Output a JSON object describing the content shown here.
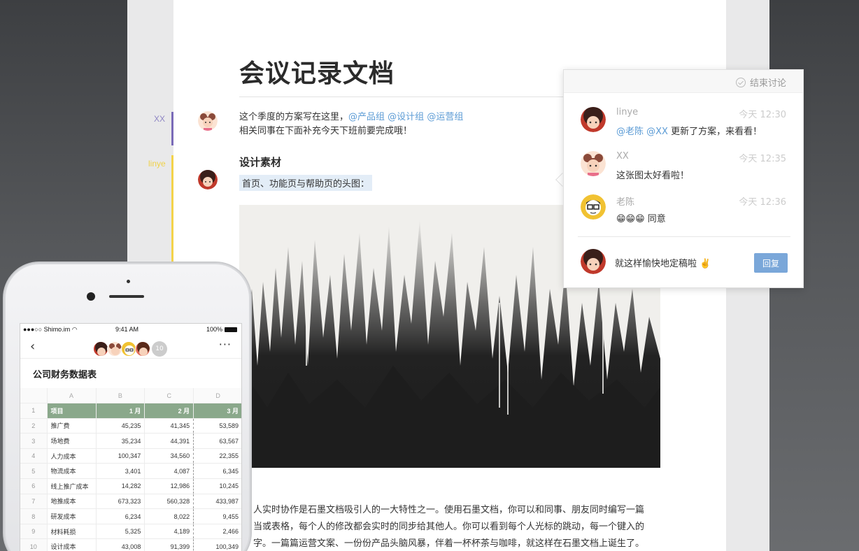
{
  "document": {
    "title": "会议记录文档",
    "cursors": [
      {
        "name": "XX",
        "color": "#7a6bb8"
      },
      {
        "name": "linye",
        "color": "#f3d34a"
      }
    ],
    "para1_line1": "这个季度的方案写在这里，",
    "mentions": [
      "@产品组",
      "@设计组",
      "@运营组"
    ],
    "para1_line2": "相关同事在下面补充今天下班前要完成哦！",
    "section_heading": "设计素材",
    "highlight_text": "首页、功能页与帮助页的头图：",
    "body_lines": [
      "人实时协作是石墨文档吸引人的一大特性之一。使用石墨文档，你可以和同事、朋友同时编写一篇",
      "当或表格，每个人的修改都会实时的同步给其他人。你可以看到每个人光标的跳动，每一个键入的",
      "字。一篇篇运营文案、一份份产品头脑风暴，伴着一杯杯茶与咖啡，就这样在石墨文档上诞生了。"
    ]
  },
  "comments": {
    "end_label": "结束讨论",
    "items": [
      {
        "name": "linye",
        "time": "今天 12:30",
        "mentions": "@老陈 @XX",
        "text": " 更新了方案，来看看！"
      },
      {
        "name": "XX",
        "time": "今天 12:35",
        "mentions": "",
        "text": "这张图太好看啦！"
      },
      {
        "name": "老陈",
        "time": "今天 12:36",
        "mentions": "",
        "text": "😁😁😁  同意"
      }
    ],
    "reply_draft": "就这样愉快地定稿啦 ✌️",
    "reply_button": "回复"
  },
  "phone": {
    "status_carrier": "●●●○○ Shimo.im ",
    "status_time": "9:41 AM",
    "status_battery": "100%",
    "nav_back": "‹",
    "nav_more": "···",
    "collab_count": "10",
    "sheet_title": "公司财务数据表",
    "columns": [
      "",
      "A",
      "B",
      "C",
      "D"
    ],
    "rows": [
      [
        "1",
        "项目",
        "1 月",
        "2 月",
        "3 月"
      ],
      [
        "2",
        "推广费",
        "45,235",
        "41,345",
        "53,589"
      ],
      [
        "3",
        "场地费",
        "35,234",
        "44,391",
        "63,567"
      ],
      [
        "4",
        "人力成本",
        "100,347",
        "34,560",
        "22,355"
      ],
      [
        "5",
        "物流成本",
        "3,401",
        "4,087",
        "6,345"
      ],
      [
        "6",
        "线上推广成本",
        "14,282",
        "12,986",
        "10,245"
      ],
      [
        "7",
        "地推成本",
        "673,323",
        "560,328",
        "433,987"
      ],
      [
        "8",
        "研发成本",
        "6,234",
        "8,022",
        "9,455"
      ],
      [
        "9",
        "材料耗损",
        "5,325",
        "4,189",
        "2,466"
      ],
      [
        "10",
        "设计成本",
        "43,008",
        "91,399",
        "100,349"
      ]
    ]
  }
}
